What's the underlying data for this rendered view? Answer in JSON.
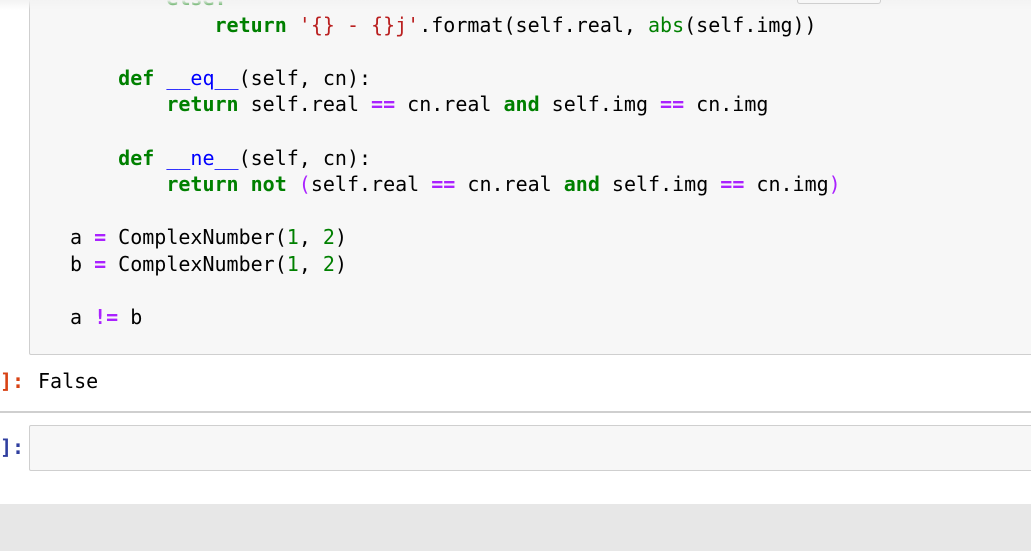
{
  "cell": {
    "lines": [
      {
        "indent": "        ",
        "parts": [
          {
            "t": "else:",
            "c": "k"
          }
        ]
      },
      {
        "indent": "            ",
        "parts": [
          {
            "t": "return",
            "c": "k"
          },
          {
            "t": " "
          },
          {
            "t": "'{} - {}j'",
            "c": "s"
          },
          {
            "t": ".format(self.real, "
          },
          {
            "t": "abs",
            "c": "b"
          },
          {
            "t": "(self.img))"
          }
        ]
      },
      {
        "indent": "",
        "parts": []
      },
      {
        "indent": "    ",
        "parts": [
          {
            "t": "def",
            "c": "k"
          },
          {
            "t": " "
          },
          {
            "t": "__eq__",
            "c": "f"
          },
          {
            "t": "(self, cn):"
          }
        ]
      },
      {
        "indent": "        ",
        "parts": [
          {
            "t": "return",
            "c": "k"
          },
          {
            "t": " self.real "
          },
          {
            "t": "==",
            "c": "o"
          },
          {
            "t": " cn.real "
          },
          {
            "t": "and",
            "c": "k"
          },
          {
            "t": " self.img "
          },
          {
            "t": "==",
            "c": "o"
          },
          {
            "t": " cn.img"
          }
        ]
      },
      {
        "indent": "",
        "parts": []
      },
      {
        "indent": "    ",
        "parts": [
          {
            "t": "def",
            "c": "k"
          },
          {
            "t": " "
          },
          {
            "t": "__ne__",
            "c": "f"
          },
          {
            "t": "(self, cn):"
          }
        ]
      },
      {
        "indent": "        ",
        "parts": [
          {
            "t": "return",
            "c": "k"
          },
          {
            "t": " "
          },
          {
            "t": "not",
            "c": "k"
          },
          {
            "t": " "
          },
          {
            "t": "(",
            "c": "p"
          },
          {
            "t": "self.real "
          },
          {
            "t": "==",
            "c": "o"
          },
          {
            "t": " cn.real "
          },
          {
            "t": "and",
            "c": "k"
          },
          {
            "t": " self.img "
          },
          {
            "t": "==",
            "c": "o"
          },
          {
            "t": " cn.img"
          },
          {
            "t": ")",
            "c": "p"
          }
        ]
      },
      {
        "indent": "",
        "parts": []
      },
      {
        "indent": "",
        "parts": [
          {
            "t": "a "
          },
          {
            "t": "=",
            "c": "o"
          },
          {
            "t": " ComplexNumber("
          },
          {
            "t": "1",
            "c": "n"
          },
          {
            "t": ", "
          },
          {
            "t": "2",
            "c": "n"
          },
          {
            "t": ")"
          }
        ]
      },
      {
        "indent": "",
        "parts": [
          {
            "t": "b "
          },
          {
            "t": "=",
            "c": "o"
          },
          {
            "t": " ComplexNumber("
          },
          {
            "t": "1",
            "c": "n"
          },
          {
            "t": ", "
          },
          {
            "t": "2",
            "c": "n"
          },
          {
            "t": ")"
          }
        ]
      },
      {
        "indent": "",
        "parts": []
      },
      {
        "indent": "",
        "parts": [
          {
            "t": "a "
          },
          {
            "t": "!=",
            "c": "o"
          },
          {
            "t": " b"
          }
        ]
      }
    ]
  },
  "output": {
    "prompt": "]:",
    "text": "False"
  },
  "next_cell": {
    "prompt": "]:",
    "value": ""
  }
}
